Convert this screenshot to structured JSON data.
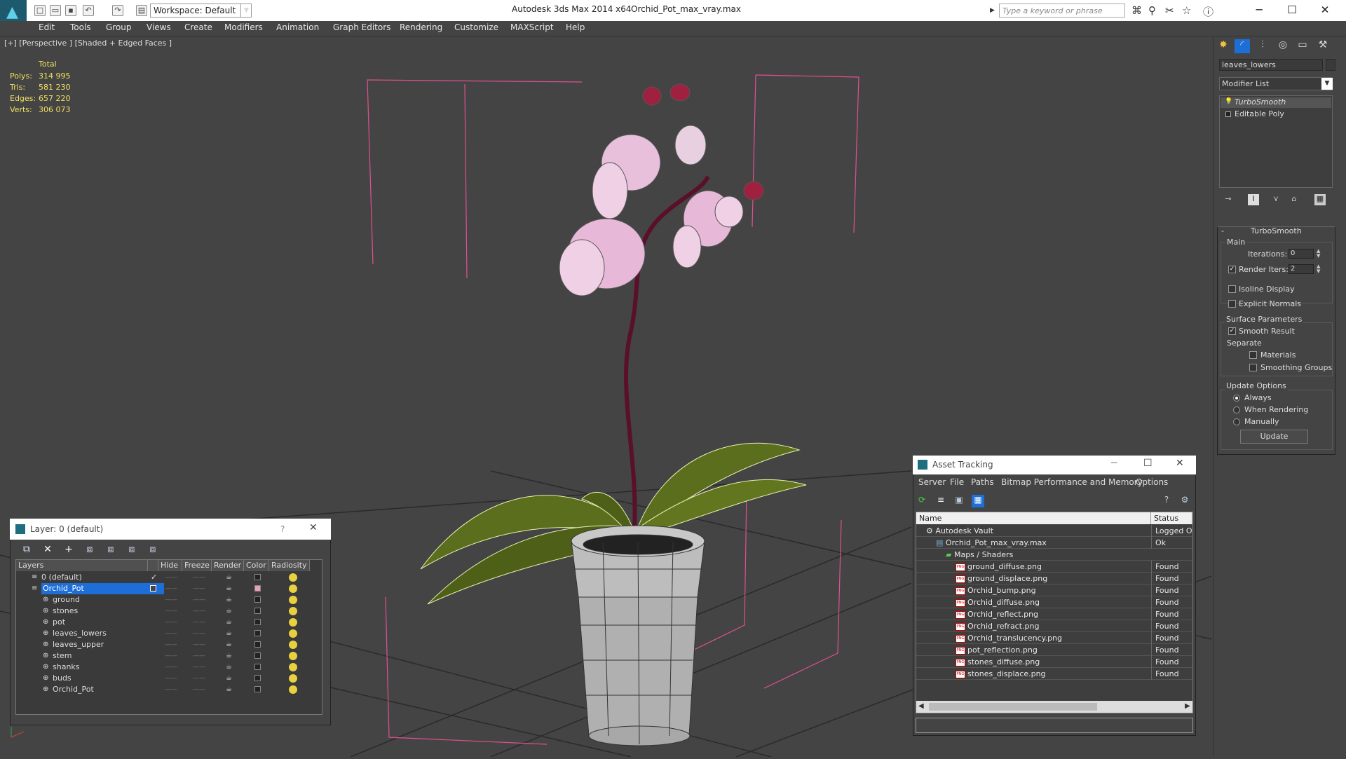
{
  "app": {
    "title": "Autodesk 3ds Max  2014 x64",
    "file": "Orchid_Pot_max_vray.max",
    "workspace": "Workspace: Default",
    "search_placeholder": "Type a keyword or phrase"
  },
  "menu": [
    "Edit",
    "Tools",
    "Group",
    "Views",
    "Create",
    "Modifiers",
    "Animation",
    "Graph Editors",
    "Rendering",
    "Customize",
    "MAXScript",
    "Help"
  ],
  "viewport": {
    "label": "[+] [Perspective ] [Shaded + Edged Faces ]",
    "stats": {
      "header": "Total",
      "rows": [
        {
          "label": "Polys:",
          "value": "314 995"
        },
        {
          "label": "Tris:",
          "value": "581 230"
        },
        {
          "label": "Edges:",
          "value": "657 220"
        },
        {
          "label": "Verts:",
          "value": "306 073"
        }
      ]
    }
  },
  "command_panel": {
    "object_name": "leaves_lowers",
    "modifier_list": "Modifier List",
    "stack": [
      "TurboSmooth",
      "Editable Poly"
    ],
    "turbosmooth": {
      "title": "TurboSmooth",
      "main": "Main",
      "iterations_label": "Iterations:",
      "iterations": "0",
      "render_iters_label": "Render Iters:",
      "render_iters": "2",
      "isoline": "Isoline Display",
      "explicit": "Explicit Normals",
      "surface": "Surface Parameters",
      "smooth_result": "Smooth Result",
      "separate": "Separate",
      "materials": "Materials",
      "smoothing_groups": "Smoothing Groups",
      "update_options": "Update Options",
      "always": "Always",
      "when_rendering": "When Rendering",
      "manually": "Manually",
      "update": "Update"
    }
  },
  "layer_window": {
    "title": "Layer: 0 (default)",
    "help": "?",
    "columns": [
      "Layers",
      "Hide",
      "Freeze",
      "Render",
      "Color",
      "Radiosity"
    ],
    "rows": [
      {
        "name": "0 (default)",
        "indent": 1,
        "color": "#222222"
      },
      {
        "name": "Orchid_Pot",
        "indent": 1,
        "color": "#e8a0b8",
        "selected": true
      },
      {
        "name": "ground",
        "indent": 2,
        "color": "#222222"
      },
      {
        "name": "stones",
        "indent": 2,
        "color": "#222222"
      },
      {
        "name": "pot",
        "indent": 2,
        "color": "#222222"
      },
      {
        "name": "leaves_lowers",
        "indent": 2,
        "color": "#222222"
      },
      {
        "name": "leaves_upper",
        "indent": 2,
        "color": "#222222"
      },
      {
        "name": "stem",
        "indent": 2,
        "color": "#222222"
      },
      {
        "name": "shanks",
        "indent": 2,
        "color": "#222222"
      },
      {
        "name": "buds",
        "indent": 2,
        "color": "#222222"
      },
      {
        "name": "Orchid_Pot",
        "indent": 2,
        "color": "#222222"
      }
    ]
  },
  "asset_tracking": {
    "title": "Asset Tracking",
    "menu": [
      "Server",
      "File",
      "Paths",
      "Bitmap Performance and Memory",
      "Options"
    ],
    "columns": [
      "Name",
      "Status"
    ],
    "rows": [
      {
        "name": "Autodesk Vault",
        "status": "Logged Ou",
        "indent": 0,
        "icon": "vault"
      },
      {
        "name": "Orchid_Pot_max_vray.max",
        "status": "Ok",
        "indent": 1,
        "icon": "max"
      },
      {
        "name": "Maps / Shaders",
        "status": "",
        "indent": 2,
        "icon": "maps"
      },
      {
        "name": "ground_diffuse.png",
        "status": "Found",
        "indent": 3,
        "icon": "png"
      },
      {
        "name": "ground_displace.png",
        "status": "Found",
        "indent": 3,
        "icon": "png"
      },
      {
        "name": "Orchid_bump.png",
        "status": "Found",
        "indent": 3,
        "icon": "png"
      },
      {
        "name": "Orchid_diffuse.png",
        "status": "Found",
        "indent": 3,
        "icon": "png"
      },
      {
        "name": "Orchid_reflect.png",
        "status": "Found",
        "indent": 3,
        "icon": "png"
      },
      {
        "name": "Orchid_refract.png",
        "status": "Found",
        "indent": 3,
        "icon": "png"
      },
      {
        "name": "Orchid_translucency.png",
        "status": "Found",
        "indent": 3,
        "icon": "png"
      },
      {
        "name": "pot_reflection.png",
        "status": "Found",
        "indent": 3,
        "icon": "png"
      },
      {
        "name": "stones_diffuse.png",
        "status": "Found",
        "indent": 3,
        "icon": "png"
      },
      {
        "name": "stones_displace.png",
        "status": "Found",
        "indent": 3,
        "icon": "png"
      }
    ]
  },
  "colors": {
    "viewport_bg": "#444444",
    "selection": "#1e6ed8",
    "leaf_green": "#5a6e1e",
    "orchid_pink": "#e8b8d8",
    "stats_yellow": "#f0e060",
    "frame_pink": "#e05090"
  }
}
